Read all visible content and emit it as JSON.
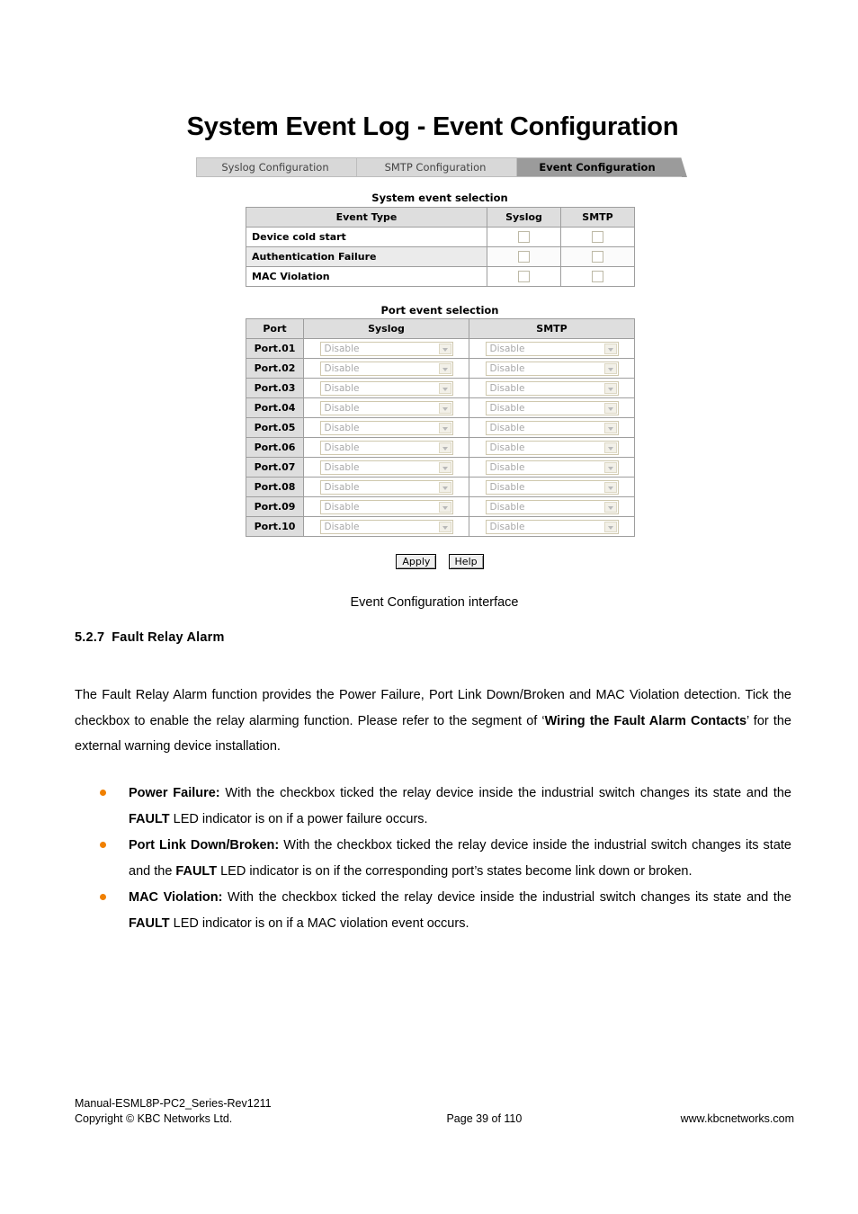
{
  "screenshot": {
    "title": "System Event Log - Event Configuration",
    "tabs": [
      {
        "label": "Syslog Configuration",
        "active": false
      },
      {
        "label": "SMTP Configuration",
        "active": false
      },
      {
        "label": "Event Configuration",
        "active": true
      }
    ],
    "system_event_selection": {
      "caption": "System event selection",
      "columns": [
        "Event Type",
        "Syslog",
        "SMTP"
      ],
      "rows": [
        {
          "event_type": "Device cold start",
          "syslog": false,
          "smtp": false
        },
        {
          "event_type": "Authentication Failure",
          "syslog": false,
          "smtp": false
        },
        {
          "event_type": "MAC Violation",
          "syslog": false,
          "smtp": false
        }
      ]
    },
    "port_event_selection": {
      "caption": "Port event selection",
      "columns": [
        "Port",
        "Syslog",
        "SMTP"
      ],
      "rows": [
        {
          "port": "Port.01",
          "syslog": "Disable",
          "smtp": "Disable"
        },
        {
          "port": "Port.02",
          "syslog": "Disable",
          "smtp": "Disable"
        },
        {
          "port": "Port.03",
          "syslog": "Disable",
          "smtp": "Disable"
        },
        {
          "port": "Port.04",
          "syslog": "Disable",
          "smtp": "Disable"
        },
        {
          "port": "Port.05",
          "syslog": "Disable",
          "smtp": "Disable"
        },
        {
          "port": "Port.06",
          "syslog": "Disable",
          "smtp": "Disable"
        },
        {
          "port": "Port.07",
          "syslog": "Disable",
          "smtp": "Disable"
        },
        {
          "port": "Port.08",
          "syslog": "Disable",
          "smtp": "Disable"
        },
        {
          "port": "Port.09",
          "syslog": "Disable",
          "smtp": "Disable"
        },
        {
          "port": "Port.10",
          "syslog": "Disable",
          "smtp": "Disable"
        }
      ]
    },
    "buttons": {
      "apply": "Apply",
      "help": "Help"
    }
  },
  "document": {
    "figure_caption": "Event Configuration interface",
    "section": {
      "number": "5.2.7",
      "title": "Fault Relay Alarm"
    },
    "intro_paragraph": {
      "part1": "The Fault Relay Alarm function provides the Power Failure, Port Link Down/Broken and MAC Violation detection. Tick the checkbox to enable the relay alarming function. Please refer to the segment of ‘",
      "bold": "Wiring the Fault Alarm Contacts",
      "part2": "’ for the external warning device installation."
    },
    "bullets": [
      {
        "term": "Power Failure:",
        "text1": " With the checkbox ticked the relay device inside the industrial switch changes its state and the ",
        "bold1": "FAULT",
        "text2": " LED indicator is on if a power failure occurs."
      },
      {
        "term": "Port Link Down/Broken:",
        "text1": " With the checkbox ticked the relay device inside the industrial switch changes its state and the ",
        "bold1": "FAULT",
        "text2": " LED indicator is on if the corresponding port’s states become link down or broken."
      },
      {
        "term": "MAC Violation:",
        "text1": " With the checkbox ticked the relay device inside the industrial switch changes its state and the ",
        "bold1": "FAULT",
        "text2": " LED indicator is on if a MAC violation event occurs."
      }
    ],
    "bullet_color": "#F08000"
  },
  "footer": {
    "manual": "Manual-ESML8P-PC2_Series-Rev1211",
    "copyright": "Copyright © KBC Networks Ltd.",
    "page": "Page 39 of 110",
    "website": "www.kbcnetworks.com"
  }
}
